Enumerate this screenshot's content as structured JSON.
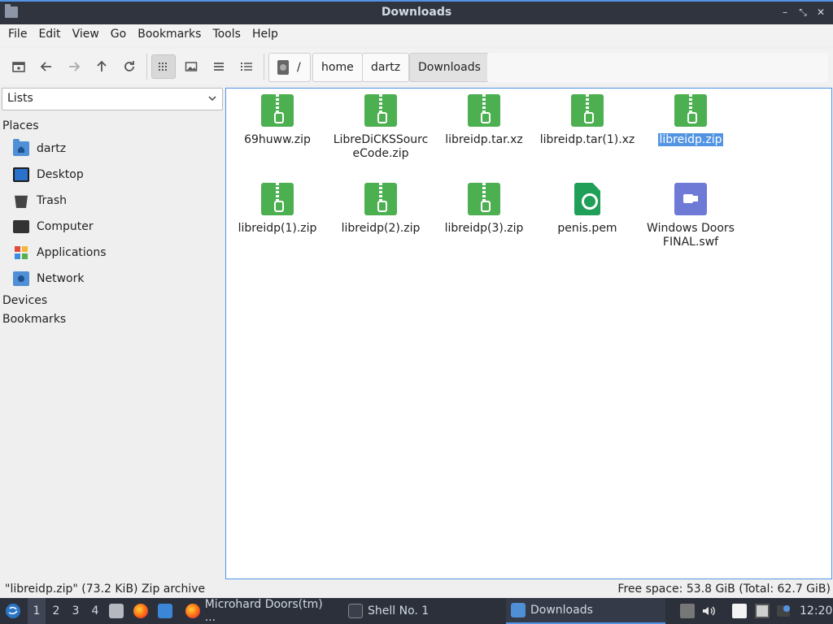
{
  "window": {
    "title": "Downloads"
  },
  "menu": [
    "File",
    "Edit",
    "View",
    "Go",
    "Bookmarks",
    "Tools",
    "Help"
  ],
  "breadcrumb": {
    "root": "/",
    "items": [
      "home",
      "dartz",
      "Downloads"
    ]
  },
  "sidebar": {
    "combo": "Lists",
    "places_label": "Places",
    "places": [
      "dartz",
      "Desktop",
      "Trash",
      "Computer",
      "Applications",
      "Network"
    ],
    "devices_label": "Devices",
    "bookmarks_label": "Bookmarks"
  },
  "files": [
    {
      "name": "69huww.zip",
      "type": "zip"
    },
    {
      "name": "LibreDiCKSSourc eCode.zip",
      "type": "zip"
    },
    {
      "name": "libreidp.tar.xz",
      "type": "zip"
    },
    {
      "name": "libreidp.tar(1).xz",
      "type": "zip"
    },
    {
      "name": "libreidp.zip",
      "type": "zip",
      "selected": true
    },
    {
      "name": "libreidp(1).zip",
      "type": "zip"
    },
    {
      "name": "libreidp(2).zip",
      "type": "zip"
    },
    {
      "name": "libreidp(3).zip",
      "type": "zip"
    },
    {
      "name": "penis.pem",
      "type": "pem"
    },
    {
      "name": "Windows Doors FINAL.swf",
      "type": "swf"
    }
  ],
  "status": {
    "left": "\"libreidp.zip\" (73.2 KiB) Zip archive",
    "right": "Free space: 53.8 GiB (Total: 62.7 GiB)"
  },
  "taskbar": {
    "workspaces": [
      "1",
      "2",
      "3",
      "4"
    ],
    "tasks": [
      "Microhard Doors(tm) ...",
      "Shell No. 1",
      "Downloads"
    ],
    "clock": "12:20"
  },
  "colors": {
    "accent": "#5294e2",
    "zip": "#4caf50",
    "pem": "#1f9f57",
    "swf": "#6f79d6",
    "taskbar": "#2b303b"
  }
}
